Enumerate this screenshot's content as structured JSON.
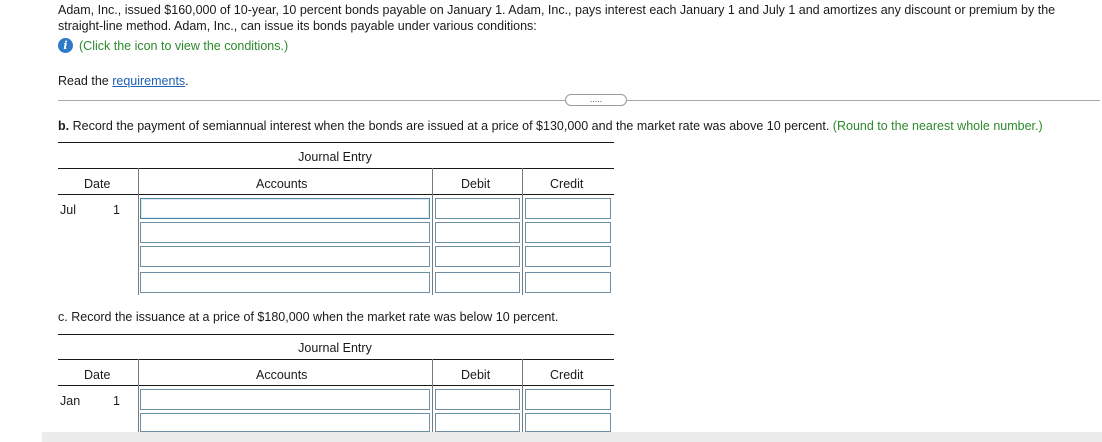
{
  "intro_text": "Adam, Inc., issued $160,000 of 10-year, 10 percent bonds payable on January 1. Adam, Inc., pays interest each January 1 and July 1 and amortizes any discount or premium by the straight-line method. Adam, Inc., can issue its bonds payable under various conditions:",
  "conditions_link": "(Click the icon to view the conditions.)",
  "requirements": {
    "prefix": "Read the ",
    "link": "requirements",
    "suffix": "."
  },
  "more_button": ".....",
  "part_b": {
    "label": "b.",
    "text": "Record the payment of semiannual interest when the bonds are issued at a price of $130,000 and the market rate was above 10 percent.",
    "hint": "(Round to the nearest whole number.)",
    "journal_title": "Journal Entry",
    "headers": {
      "date": "Date",
      "accounts": "Accounts",
      "debit": "Debit",
      "credit": "Credit"
    },
    "date_month": "Jul",
    "date_day": "1"
  },
  "part_c": {
    "label": "c.",
    "text": "Record the issuance at a price of $180,000 when the market rate was below 10 percent.",
    "journal_title": "Journal Entry",
    "headers": {
      "date": "Date",
      "accounts": "Accounts",
      "debit": "Debit",
      "credit": "Credit"
    },
    "date_month": "Jan",
    "date_day": "1"
  },
  "colors": {
    "link": "#1f5fb5",
    "hint_green": "#2c8a2c",
    "info_icon": "#2e7ac9",
    "input_border": "#6f8fa6"
  }
}
